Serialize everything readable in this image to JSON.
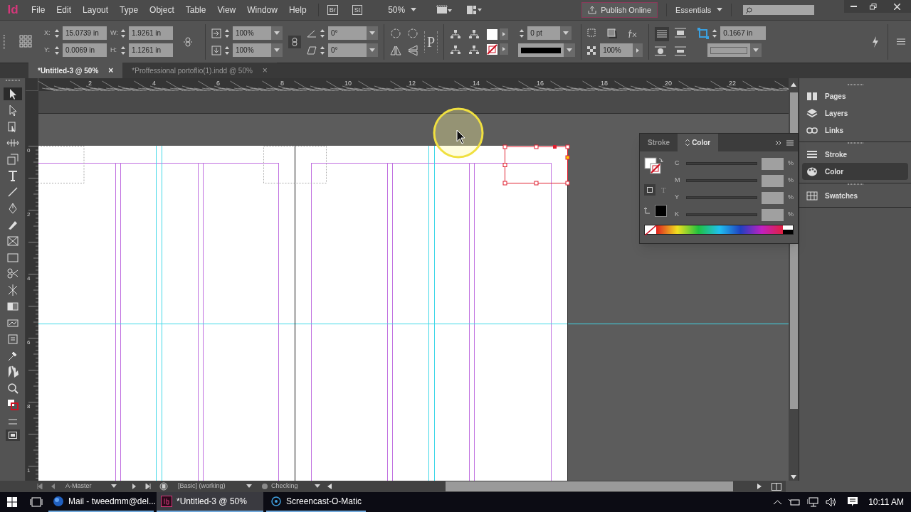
{
  "app_logo": "Id",
  "menu": [
    "File",
    "Edit",
    "Layout",
    "Type",
    "Object",
    "Table",
    "View",
    "Window",
    "Help"
  ],
  "bridge_button": "Br",
  "stock_button": "St",
  "zoom": "50%",
  "publish_button": "Publish Online",
  "workspace": "Essentials",
  "control_panel": {
    "position": [
      {
        "label": "X:",
        "value": "15.0739 in"
      },
      {
        "label": "Y:",
        "value": "0.0069 in"
      }
    ],
    "size": [
      {
        "label": "W:",
        "value": "1.9261 in"
      },
      {
        "label": "H:",
        "value": "1.1261 in"
      }
    ],
    "scale": [
      "100%",
      "100%"
    ],
    "angles": [
      "0°",
      "0°"
    ],
    "frame_glyph": "P",
    "stroke_weight": "0 pt",
    "opacity": "100%",
    "frame_offset": "0.1667 in"
  },
  "tabs": [
    {
      "label": "*Untitled-3 @ 50%",
      "selected": true,
      "close": "×"
    },
    {
      "label": "*Proffessional portoflio(1).indd @ 50%",
      "selected": false,
      "close": "×"
    }
  ],
  "tools": [
    {
      "selected": true
    },
    {
      "selected": false
    },
    {
      "selected": false
    },
    {
      "selected": false
    },
    {
      "selected": false
    },
    {
      "selected": false
    },
    {
      "selected": false
    },
    {
      "selected": false
    },
    {
      "selected": false
    },
    {
      "selected": false
    },
    {
      "selected": false
    },
    {
      "selected": false
    },
    {
      "selected": false
    },
    {
      "selected": false
    },
    {
      "selected": false
    },
    {
      "selected": false
    },
    {
      "selected": false
    },
    {
      "selected": false
    },
    {
      "selected": false
    },
    {
      "selected": false
    }
  ],
  "ruler": {
    "horizontal": [
      "2",
      "4",
      "6",
      "8",
      "10",
      "12",
      "14",
      "16",
      "18",
      "20",
      "22"
    ],
    "vertical": [
      "0",
      "2",
      "4",
      "6",
      "8",
      "1"
    ]
  },
  "color_panel": {
    "tabs": [
      {
        "label": "Stroke",
        "selected": false
      },
      {
        "label": "Color",
        "selected": true
      }
    ],
    "text_mode": "T",
    "channels": [
      {
        "name": "C",
        "unit": "%"
      },
      {
        "name": "M",
        "unit": "%"
      },
      {
        "name": "Y",
        "unit": "%"
      },
      {
        "name": "K",
        "unit": "%"
      }
    ]
  },
  "dock": [
    {
      "items": [
        {
          "label": "Pages",
          "selected": false
        },
        {
          "label": "Layers",
          "selected": false
        },
        {
          "label": "Links",
          "selected": false
        }
      ]
    },
    {
      "items": [
        {
          "label": "Stroke",
          "selected": false
        },
        {
          "label": "Color",
          "selected": true
        }
      ]
    },
    {
      "items": [
        {
          "label": "Swatches",
          "selected": false
        }
      ]
    }
  ],
  "status_bar": {
    "page": "A-Master",
    "preflight_profile": "[Basic] (working)",
    "preflight_status": "Checking"
  },
  "taskbar": {
    "apps": [
      {
        "label": "Mail - tweedmm@del...",
        "selected": false
      },
      {
        "label": "*Untitled-3 @ 50%",
        "selected": true
      },
      {
        "label": "Screencast-O-Matic",
        "selected": false
      }
    ],
    "time": "10:11 AM"
  }
}
